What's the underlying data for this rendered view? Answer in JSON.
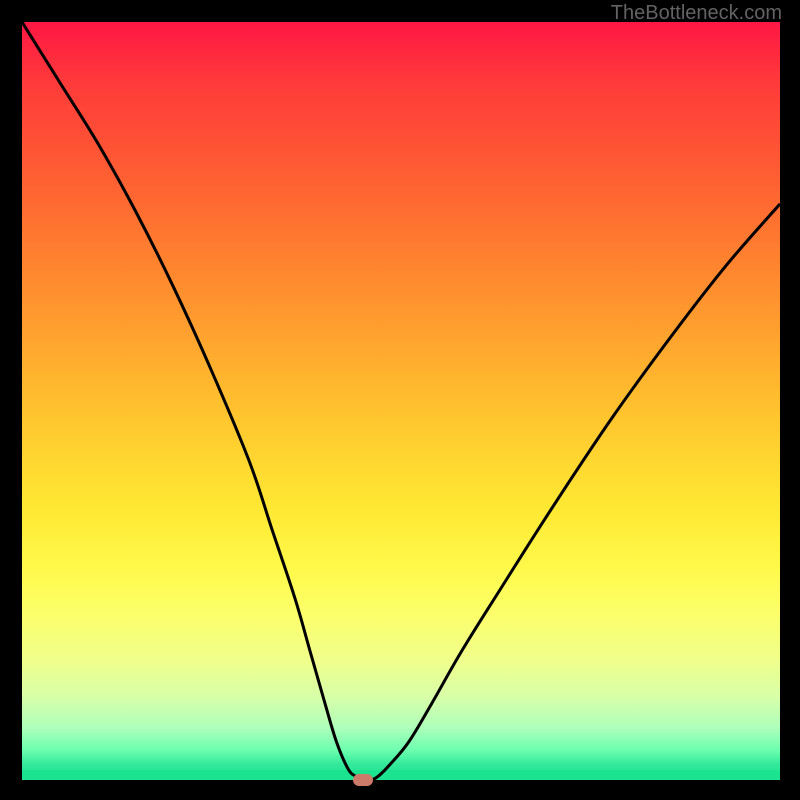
{
  "watermark": "TheBottleneck.com",
  "chart_data": {
    "type": "line",
    "title": "",
    "xlabel": "",
    "ylabel": "",
    "xlim": [
      0,
      100
    ],
    "ylim": [
      0,
      100
    ],
    "curve_points": [
      [
        0,
        100
      ],
      [
        5,
        92
      ],
      [
        10,
        84
      ],
      [
        15,
        75
      ],
      [
        20,
        65
      ],
      [
        25,
        54
      ],
      [
        30,
        42
      ],
      [
        33,
        33
      ],
      [
        36,
        24
      ],
      [
        38,
        17
      ],
      [
        40,
        10
      ],
      [
        41.5,
        5
      ],
      [
        43,
        1.5
      ],
      [
        44,
        0.5
      ],
      [
        45,
        0
      ],
      [
        46,
        0
      ],
      [
        47,
        0.5
      ],
      [
        48.5,
        2
      ],
      [
        51,
        5
      ],
      [
        54,
        10
      ],
      [
        58,
        17
      ],
      [
        63,
        25
      ],
      [
        70,
        36
      ],
      [
        78,
        48
      ],
      [
        86,
        59
      ],
      [
        93,
        68
      ],
      [
        100,
        76
      ]
    ],
    "minimum_marker": {
      "x": 45,
      "y": 0
    },
    "background_gradient": {
      "top": "#ff1744",
      "mid": "#ffd12f",
      "bottom": "#1ce38f"
    }
  },
  "colors": {
    "black": "#000000",
    "curve": "#000000",
    "marker": "#cc7a6a",
    "watermark": "#636363"
  }
}
